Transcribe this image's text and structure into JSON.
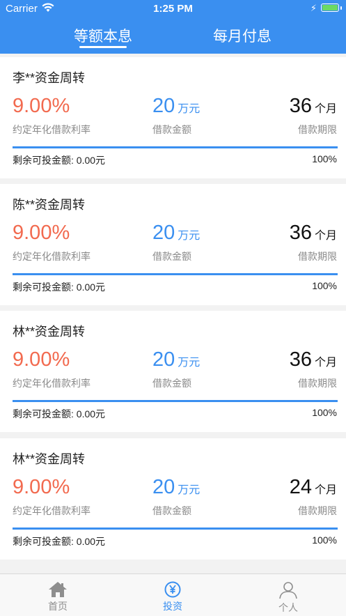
{
  "status_bar": {
    "carrier": "Carrier",
    "time": "1:25 PM"
  },
  "tabs": [
    {
      "label": "等额本息",
      "active": true
    },
    {
      "label": "每月付息",
      "active": false
    }
  ],
  "cards": [
    {
      "title": "李**资金周转",
      "rate": "9.00%",
      "rate_label": "约定年化借款利率",
      "amount": "20",
      "amount_unit": "万元",
      "amount_label": "借款金额",
      "term": "36",
      "term_unit": "个月",
      "term_label": "借款期限",
      "remaining": "剩余可投金额: 0.00元",
      "percent": "100%",
      "progress": 1.0
    },
    {
      "title": "陈**资金周转",
      "rate": "9.00%",
      "rate_label": "约定年化借款利率",
      "amount": "20",
      "amount_unit": "万元",
      "amount_label": "借款金额",
      "term": "36",
      "term_unit": "个月",
      "term_label": "借款期限",
      "remaining": "剩余可投金额: 0.00元",
      "percent": "100%",
      "progress": 1.0
    },
    {
      "title": "林**资金周转",
      "rate": "9.00%",
      "rate_label": "约定年化借款利率",
      "amount": "20",
      "amount_unit": "万元",
      "amount_label": "借款金额",
      "term": "36",
      "term_unit": "个月",
      "term_label": "借款期限",
      "remaining": "剩余可投金额: 0.00元",
      "percent": "100%",
      "progress": 1.0
    },
    {
      "title": "林**资金周转",
      "rate": "9.00%",
      "rate_label": "约定年化借款利率",
      "amount": "20",
      "amount_unit": "万元",
      "amount_label": "借款金额",
      "term": "24",
      "term_unit": "个月",
      "term_label": "借款期限",
      "remaining": "剩余可投金额: 0.00元",
      "percent": "100%",
      "progress": 1.0
    }
  ],
  "tabbar": [
    {
      "label": "首页",
      "icon": "home-icon",
      "active": false
    },
    {
      "label": "投资",
      "icon": "yen-icon",
      "active": true
    },
    {
      "label": "个人",
      "icon": "person-icon",
      "active": false
    }
  ],
  "colors": {
    "accent": "#3a8ff0",
    "rate": "#f26a4f",
    "battery": "#6cd964"
  }
}
